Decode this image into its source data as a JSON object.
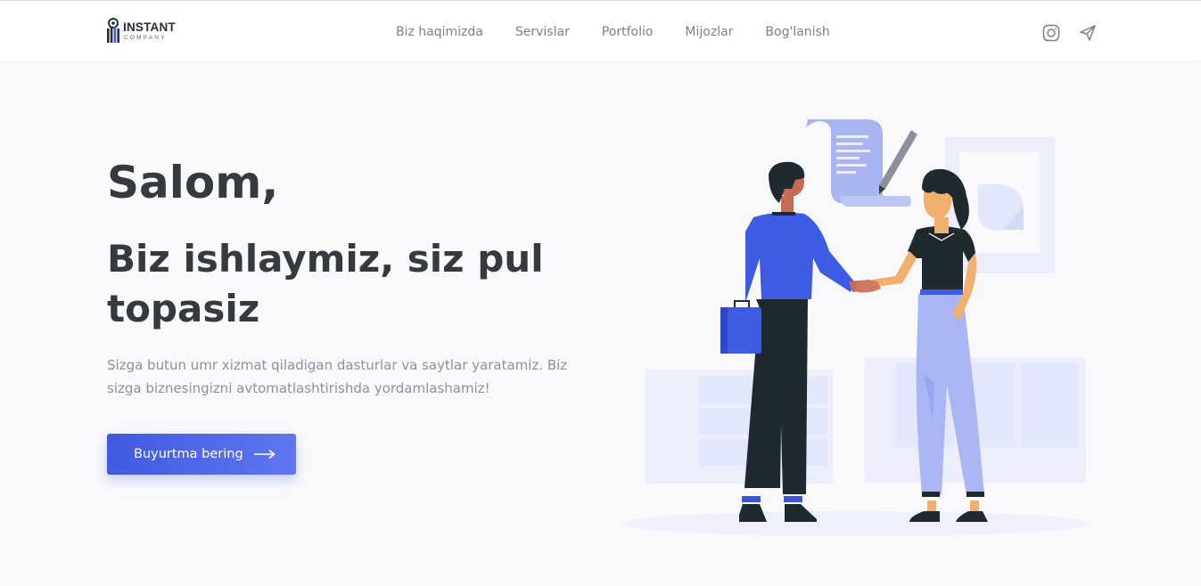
{
  "brand": {
    "name": "INSTANT",
    "tagline": "COMPANY"
  },
  "nav": {
    "items": [
      {
        "label": "Biz haqimizda"
      },
      {
        "label": "Servislar"
      },
      {
        "label": "Portfolio"
      },
      {
        "label": "Mijozlar"
      },
      {
        "label": "Bog'lanish"
      }
    ]
  },
  "social": {
    "icons": [
      "instagram-icon",
      "telegram-icon"
    ]
  },
  "hero": {
    "greeting": "Salom,",
    "title": "Biz ishlaymiz, siz pul topasiz",
    "text": "Sizga butun umr xizmat qiladigan dasturlar va saytlar yaratamiz. Biz sizga biznesingizni avtomatlashtirishda yordamlashamiz!",
    "cta_label": "Buyurtma bering"
  },
  "colors": {
    "accent": "#4159e0",
    "text_dark": "#343a40",
    "text_muted": "#8c90a0",
    "background": "#f9f9fc"
  }
}
